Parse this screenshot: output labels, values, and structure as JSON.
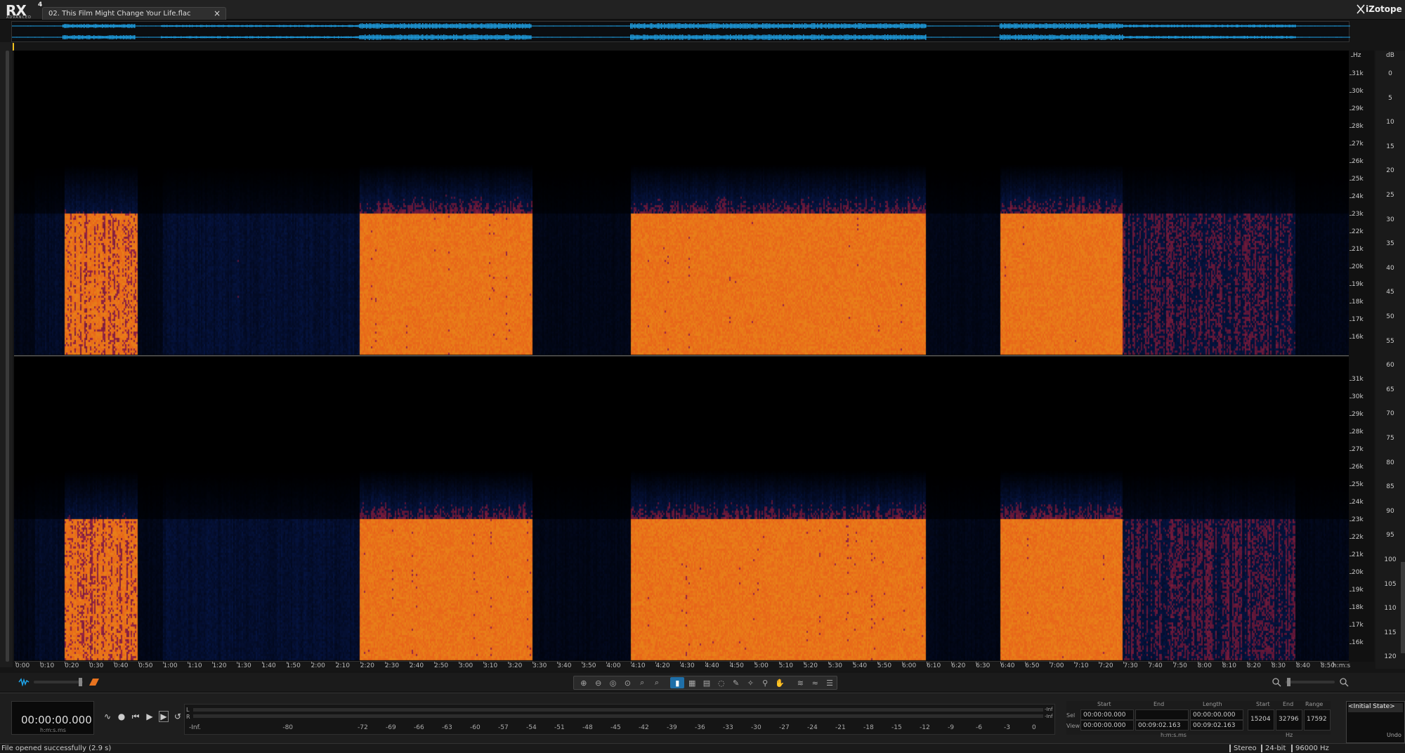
{
  "app": {
    "logo_text": "RX",
    "logo_version": "4",
    "logo_edition": "ADVANCED",
    "brand": "iZotope",
    "file_tab": "02. This Film Might Change Your Life.flac",
    "close_glyph": "×"
  },
  "colors": {
    "waveform": "#1fa3e8",
    "spectrum_hot": "#e8731f",
    "spectrum_cold": "#1e3566",
    "background": "#000000",
    "selected_tool": "#1f6fa8"
  },
  "freq_axis": {
    "unit": "Hz",
    "top_channel_ticks": [
      "31k",
      "30k",
      "29k",
      "28k",
      "27k",
      "26k",
      "25k",
      "24k",
      "23k",
      "22k",
      "21k",
      "20k",
      "19k",
      "18k",
      "17k",
      "16k"
    ],
    "bottom_channel_ticks": [
      "31k",
      "30k",
      "29k",
      "28k",
      "27k",
      "26k",
      "25k",
      "24k",
      "23k",
      "22k",
      "21k",
      "20k",
      "19k",
      "18k",
      "17k",
      "16k"
    ]
  },
  "db_axis": {
    "unit": "dB",
    "ticks": [
      "0",
      "5",
      "10",
      "15",
      "20",
      "25",
      "30",
      "35",
      "40",
      "45",
      "50",
      "55",
      "60",
      "65",
      "70",
      "75",
      "80",
      "85",
      "90",
      "95",
      "100",
      "105",
      "110",
      "115",
      "120"
    ]
  },
  "time_axis": {
    "unit": "h:m:s",
    "ticks": [
      "0:00",
      "0:10",
      "0:20",
      "0:30",
      "0:40",
      "0:50",
      "1:00",
      "1:10",
      "1:20",
      "1:30",
      "1:40",
      "1:50",
      "2:00",
      "2:10",
      "2:20",
      "2:30",
      "2:40",
      "2:50",
      "3:00",
      "3:10",
      "3:20",
      "3:30",
      "3:40",
      "3:50",
      "4:00",
      "4:10",
      "4:20",
      "4:30",
      "4:40",
      "4:50",
      "5:00",
      "5:10",
      "5:20",
      "5:30",
      "5:40",
      "5:50",
      "6:00",
      "6:10",
      "6:20",
      "6:30",
      "6:40",
      "6:50",
      "7:00",
      "7:10",
      "7:20",
      "7:30",
      "7:40",
      "7:50",
      "8:00",
      "8:10",
      "8:20",
      "8:30",
      "8:40",
      "8:50"
    ]
  },
  "audio_sections": [
    {
      "start": "0:20",
      "end": "0:50",
      "intensity": "medium"
    },
    {
      "start": "2:20",
      "end": "3:30",
      "intensity": "high"
    },
    {
      "start": "4:10",
      "end": "6:10",
      "intensity": "high"
    },
    {
      "start": "6:40",
      "end": "7:30",
      "intensity": "high"
    },
    {
      "start": "7:30",
      "end": "8:40",
      "intensity": "low"
    }
  ],
  "tools": [
    {
      "name": "zoom-in-icon",
      "glyph": "⊕"
    },
    {
      "name": "zoom-out-icon",
      "glyph": "⊖"
    },
    {
      "name": "zoom-fit-icon",
      "glyph": "◎"
    },
    {
      "name": "zoom-selection-icon",
      "glyph": "⊙"
    },
    {
      "name": "zoom-time-icon",
      "glyph": "⌕"
    },
    {
      "name": "zoom-frequency-icon",
      "glyph": "⌕"
    },
    {
      "name": "time-selection-icon",
      "glyph": "▮"
    },
    {
      "name": "time-frequency-selection-icon",
      "glyph": "▦"
    },
    {
      "name": "frequency-selection-icon",
      "glyph": "▤"
    },
    {
      "name": "lasso-icon",
      "glyph": "◌"
    },
    {
      "name": "brush-icon",
      "glyph": "✎"
    },
    {
      "name": "magic-wand-icon",
      "glyph": "✧"
    },
    {
      "name": "magnifier-icon",
      "glyph": "⚲"
    },
    {
      "name": "hand-icon",
      "glyph": "✋"
    },
    {
      "name": "spectrum-icon",
      "glyph": "≋"
    },
    {
      "name": "harmonic-icon",
      "glyph": "≈"
    },
    {
      "name": "list-icon",
      "glyph": "☰"
    }
  ],
  "transport": {
    "time_value": "00:00:00.000",
    "time_unit": "h:m:s.ms",
    "buttons": [
      "∿",
      "●",
      "⏮",
      "▶",
      "▶",
      "↺"
    ]
  },
  "meter": {
    "l_label": "L",
    "r_label": "R",
    "inf_label_l": "-Inf",
    "inf_label_r": "-Inf",
    "ticks": [
      "-Inf.",
      "-80",
      "-72",
      "-69",
      "-66",
      "-63",
      "-60",
      "-57",
      "-54",
      "-51",
      "-48",
      "-45",
      "-42",
      "-39",
      "-36",
      "-33",
      "-30",
      "-27",
      "-24",
      "-21",
      "-18",
      "-15",
      "-12",
      "-9",
      "-6",
      "-3",
      "0"
    ]
  },
  "selection": {
    "headers": {
      "start": "Start",
      "end": "End",
      "length": "Length",
      "fstart": "Start",
      "fend": "End",
      "range": "Range"
    },
    "sel_label": "Sel",
    "view_label": "View",
    "sel": {
      "start": "00:00:00.000",
      "end": "",
      "length": "00:00:00.000"
    },
    "view": {
      "start": "00:00:00.000",
      "end": "00:09:02.163",
      "length": "00:09:02.163"
    },
    "time_unit": "h:m:s.ms",
    "freq": {
      "start": "15204",
      "end": "32796",
      "range": "17592",
      "unit": "Hz"
    }
  },
  "history": {
    "item": "<Initial State>",
    "undo": "Undo"
  },
  "status": {
    "message": "File opened successfully (2.9 s)",
    "channels": "Stereo",
    "bit_depth": "24-bit",
    "sample_rate": "96000 Hz"
  }
}
